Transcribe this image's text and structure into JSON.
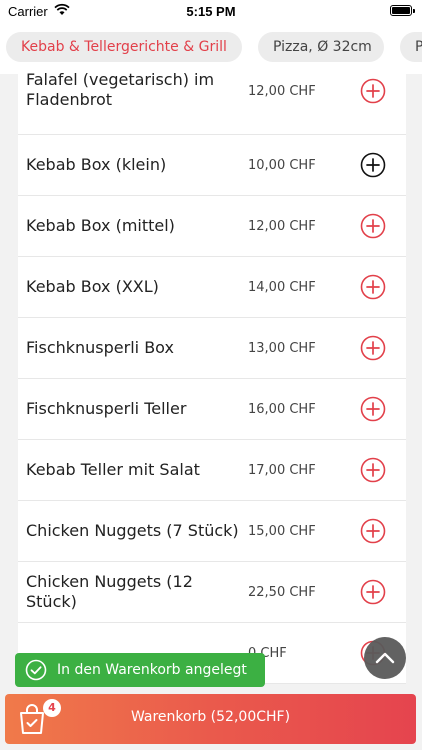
{
  "status_bar": {
    "carrier": "Carrier",
    "time": "5:15 PM"
  },
  "category_tabs": [
    {
      "label": "Kebab & Tellergerichte & Grill",
      "active": true
    },
    {
      "label": "Pizza, Ø 32cm",
      "active": false
    },
    {
      "label": "P",
      "active": false
    }
  ],
  "menu_items": [
    {
      "name": "Falafel (vegetarisch) im Fladenbrot",
      "price": "12,00 CHF",
      "add_icon_color": "#e2404a"
    },
    {
      "name": "Kebab Box (klein)",
      "price": "10,00 CHF",
      "add_icon_color": "#111111"
    },
    {
      "name": "Kebab Box (mittel)",
      "price": "12,00 CHF",
      "add_icon_color": "#e2404a"
    },
    {
      "name": "Kebab Box (XXL)",
      "price": "14,00 CHF",
      "add_icon_color": "#e2404a"
    },
    {
      "name": "Fischknusperli Box",
      "price": "13,00 CHF",
      "add_icon_color": "#e2404a"
    },
    {
      "name": "Fischknusperli Teller",
      "price": "16,00 CHF",
      "add_icon_color": "#e2404a"
    },
    {
      "name": "Kebab Teller mit Salat",
      "price": "17,00 CHF",
      "add_icon_color": "#e2404a"
    },
    {
      "name": "Chicken Nuggets (7 Stück)",
      "price": "15,00 CHF",
      "add_icon_color": "#e2404a"
    },
    {
      "name": "Chicken Nuggets (12 Stück)",
      "price": "22,50 CHF",
      "add_icon_color": "#e2404a"
    },
    {
      "name": "",
      "price": "0 CHF",
      "add_icon_color": "#e2404a"
    }
  ],
  "toast": {
    "text": "In den Warenkorb angelegt"
  },
  "cart": {
    "badge_count": "4",
    "label": "Warenkorb (52,00CHF)"
  },
  "colors": {
    "accent": "#e2404a",
    "toast": "#3cb043"
  }
}
